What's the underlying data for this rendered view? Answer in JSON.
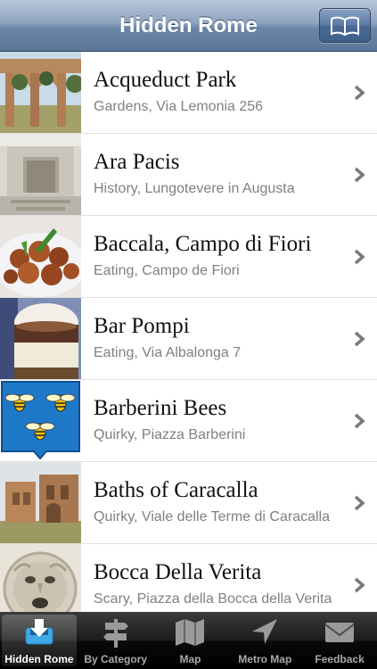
{
  "nav": {
    "title": "Hidden Rome",
    "guide_button_icon": "open-book-icon"
  },
  "places": [
    {
      "title": "Acqueduct Park",
      "subtitle": "Gardens, Via Lemonia 256"
    },
    {
      "title": "Ara Pacis",
      "subtitle": "History, Lungotevere in Augusta"
    },
    {
      "title": "Baccala, Campo di Fiori",
      "subtitle": "Eating, Campo de Fiori"
    },
    {
      "title": "Bar Pompi",
      "subtitle": "Eating, Via Albalonga 7"
    },
    {
      "title": "Barberini Bees",
      "subtitle": "Quirky, Piazza Barberini"
    },
    {
      "title": "Baths of Caracalla",
      "subtitle": "Quirky, Viale delle Terme di Caracalla"
    },
    {
      "title": "Bocca Della Verita",
      "subtitle": "Scary, Piazza della Bocca della Verita"
    }
  ],
  "tabs": [
    {
      "label": "Hidden Rome",
      "icon": "download-tray-icon",
      "active": true
    },
    {
      "label": "By Category",
      "icon": "signpost-icon",
      "active": false
    },
    {
      "label": "Map",
      "icon": "folded-map-icon",
      "active": false
    },
    {
      "label": "Metro Map",
      "icon": "navigation-arrow-icon",
      "active": false
    },
    {
      "label": "Feedback",
      "icon": "envelope-icon",
      "active": false
    }
  ],
  "colors": {
    "navbar": "#6c86a8",
    "tabbar": "#1c1c1c",
    "active_tab_icon": "#3fa9e6"
  }
}
